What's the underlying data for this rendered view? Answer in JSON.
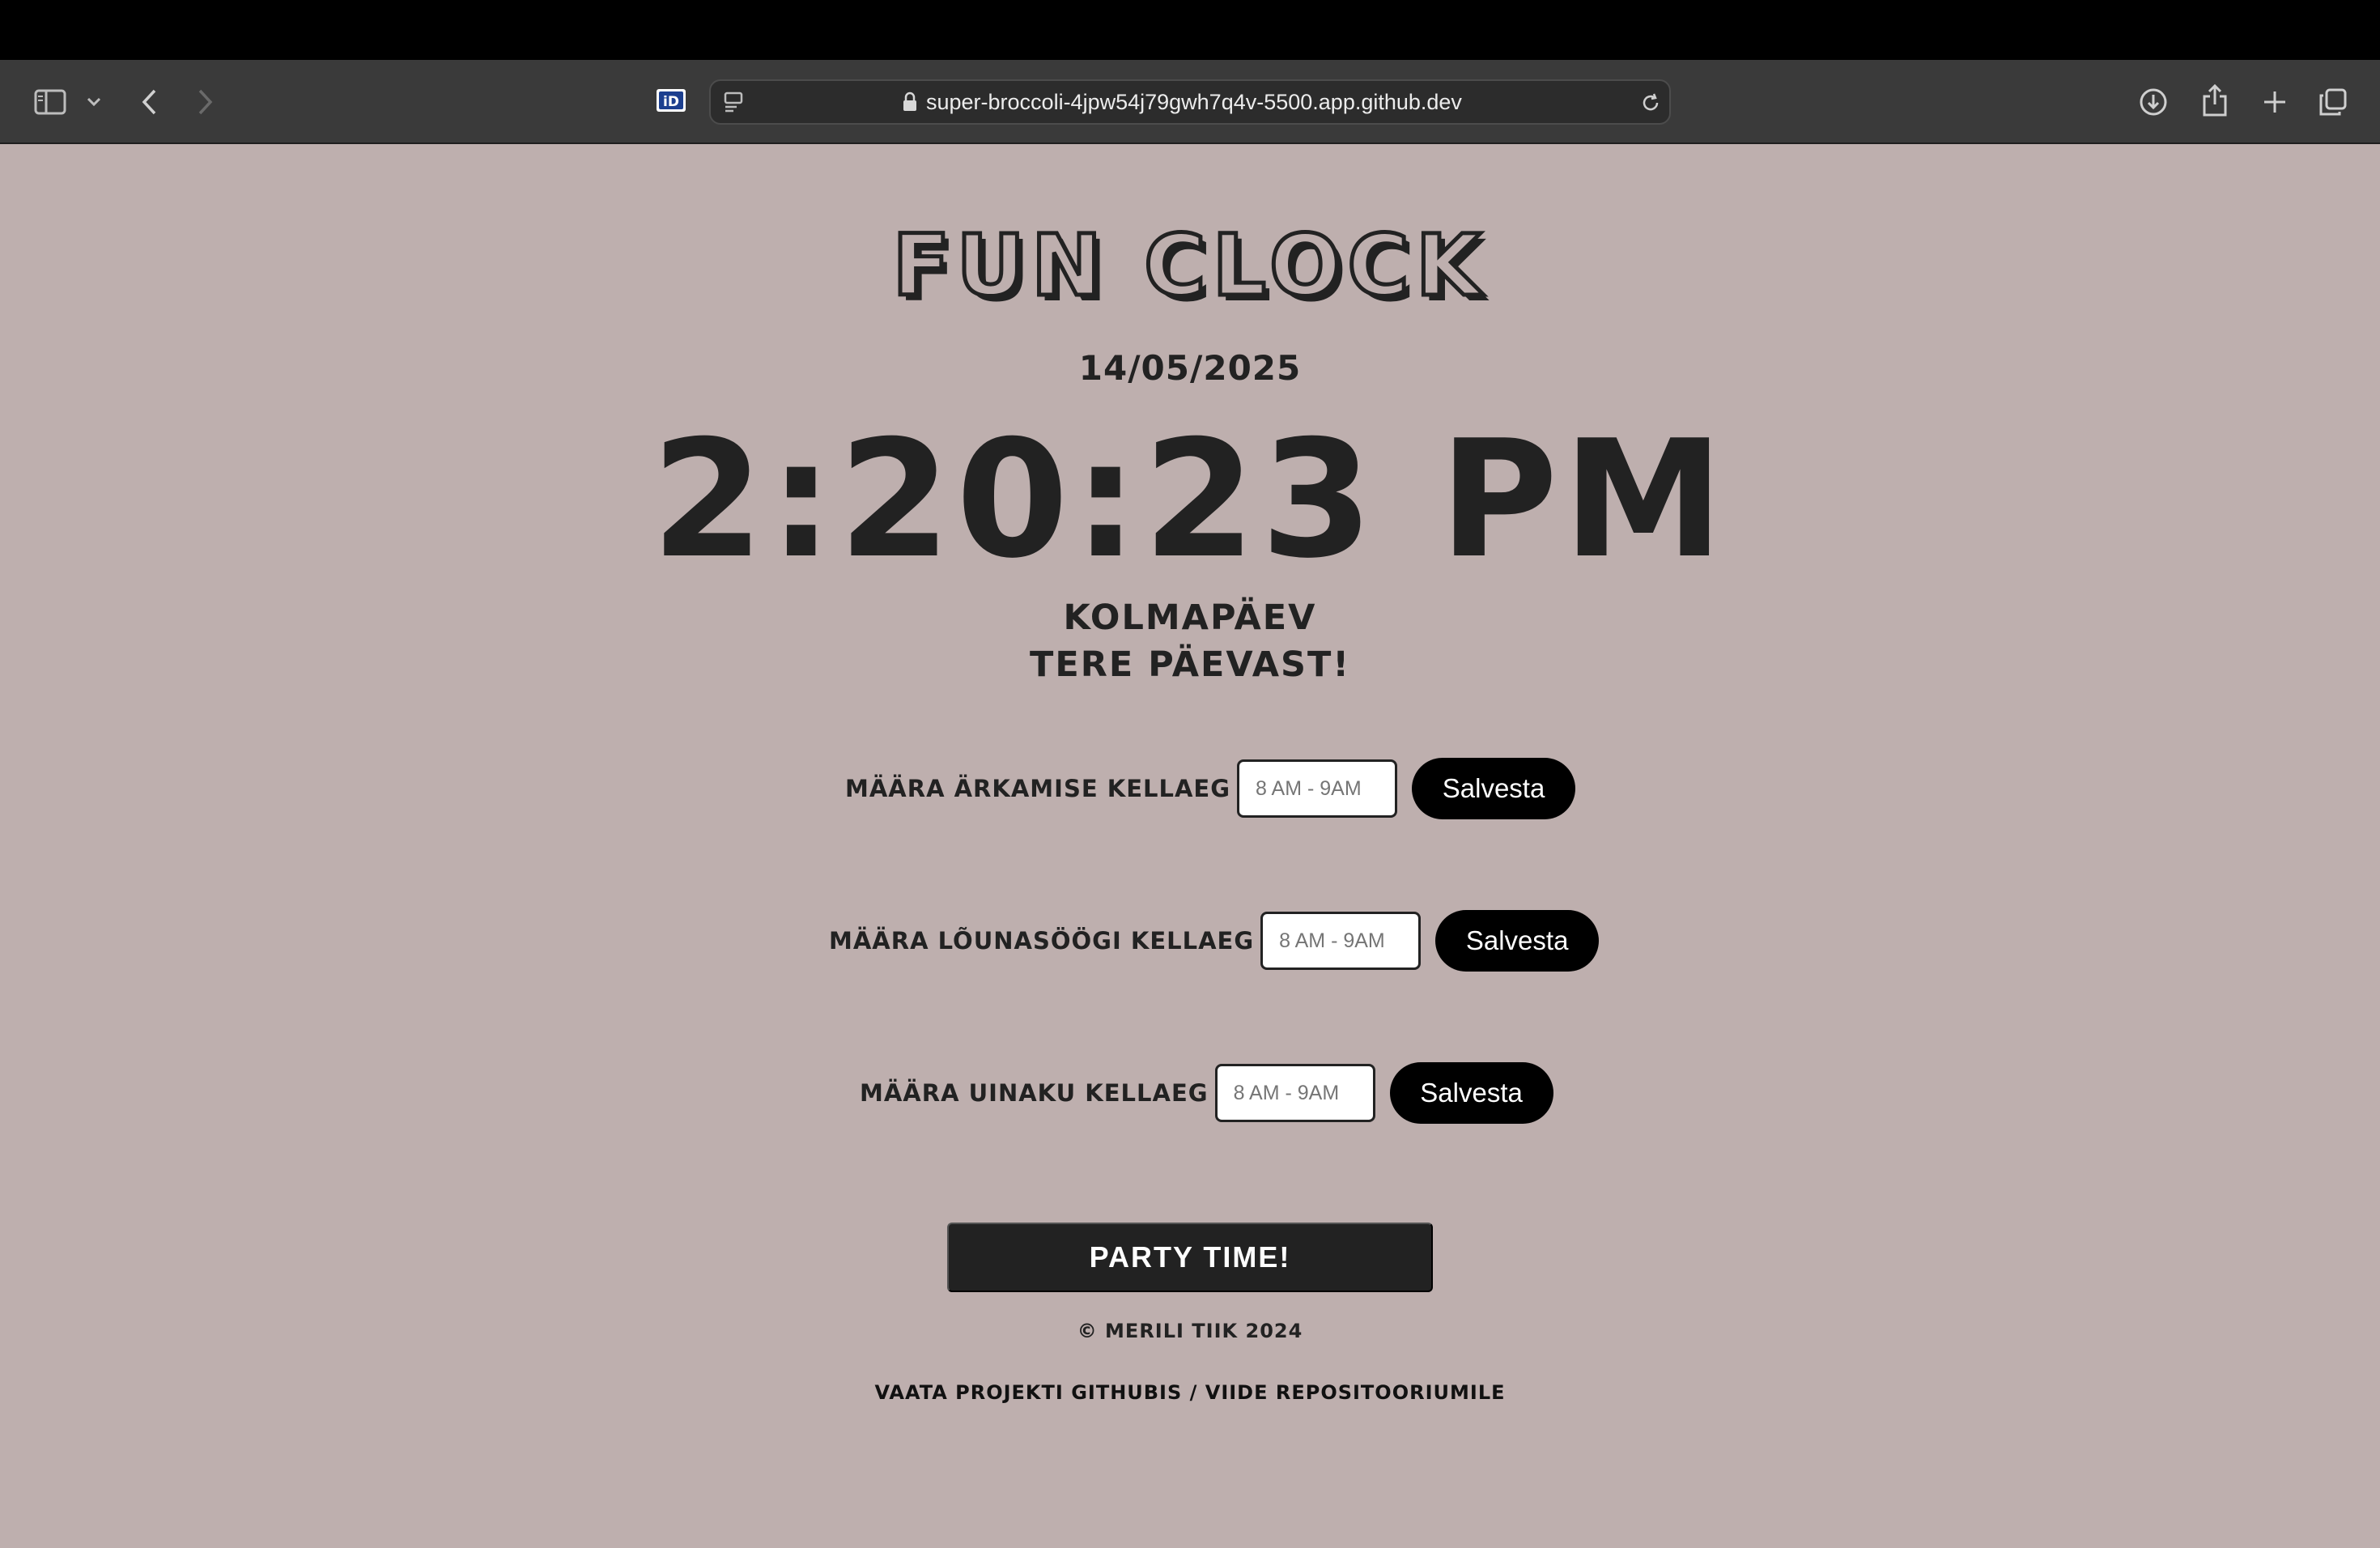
{
  "browser": {
    "url": "super-broccoli-4jpw54j79gwh7q4v-5500.app.github.dev",
    "ext_icon_text": "iD"
  },
  "app": {
    "title": "FUN CLOCK",
    "date": "14/05/2025",
    "time": "2:20:23 PM",
    "weekday": "KOLMAPÄEV",
    "greeting": "TERE PÄEVAST!"
  },
  "alarms": [
    {
      "label": "MÄÄRA ÄRKAMISE KELLAEG",
      "placeholder": "8 AM - 9AM",
      "button": "Salvesta"
    },
    {
      "label": "MÄÄRA LÕUNASÖÖGI KELLAEG",
      "placeholder": "8 AM - 9AM",
      "button": "Salvesta"
    },
    {
      "label": "MÄÄRA UINAKU KELLAEG",
      "placeholder": "8 AM - 9AM",
      "button": "Salvesta"
    }
  ],
  "party_button": "PARTY TIME!",
  "footer": {
    "copyright": "© MERILI TIIK 2024",
    "link": "VAATA PROJEKTI GITHUBIS / VIIDE REPOSITOORIUMILE"
  },
  "colors": {
    "page_background": "#beafae",
    "text": "#222222",
    "button_bg": "#000000",
    "toolbar_bg": "#3a3a3a"
  }
}
